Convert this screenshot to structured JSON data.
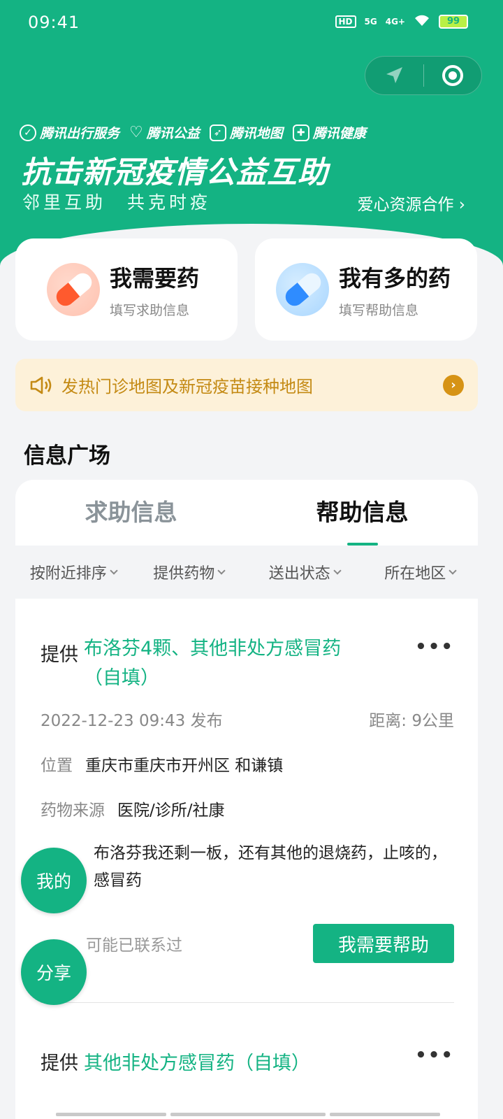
{
  "status_bar": {
    "time": "09:41",
    "hd": "HD",
    "net1": "5G",
    "net2": "4G+",
    "battery": "99"
  },
  "header": {
    "partners": [
      "腾讯出行服务",
      "腾讯公益",
      "腾讯地图",
      "腾讯健康"
    ],
    "title": "抗击新冠疫情公益互助",
    "subtitle": "邻里互助　共克时疫",
    "link": "爱心资源合作 ›"
  },
  "actions": [
    {
      "title": "我需要药",
      "subtitle": "填写求助信息"
    },
    {
      "title": "我有多的药",
      "subtitle": "填写帮助信息"
    }
  ],
  "notice": {
    "text": "发热门诊地图及新冠疫苗接种地图"
  },
  "section_title": "信息广场",
  "tabs": [
    {
      "label": "求助信息",
      "active": false
    },
    {
      "label": "帮助信息",
      "active": true
    }
  ],
  "filters": [
    "按附近排序",
    "提供药物",
    "送出状态",
    "所在地区"
  ],
  "posts": [
    {
      "prefix": "提供",
      "title": "布洛芬4颗、其他非处方感冒药（自填）",
      "time": "2022-12-23 09:43 发布",
      "distance": "距离: 9公里",
      "location_label": "位置",
      "location": "重庆市重庆市开州区 和谦镇",
      "source_label": "药物来源",
      "source": "医院/诊所/社康",
      "description": "布洛芬我还剩一板，还有其他的退烧药，止咳的，感冒药",
      "contacted": "可能已联系过",
      "button": "我需要帮助"
    },
    {
      "prefix": "提供",
      "title": "其他非处方感冒药（自填）"
    }
  ],
  "floating": {
    "mine": "我的",
    "share": "分享"
  },
  "colors": {
    "brand": "#14b383",
    "notice_bg": "#fdf1d9",
    "notice_text": "#c48a14"
  }
}
